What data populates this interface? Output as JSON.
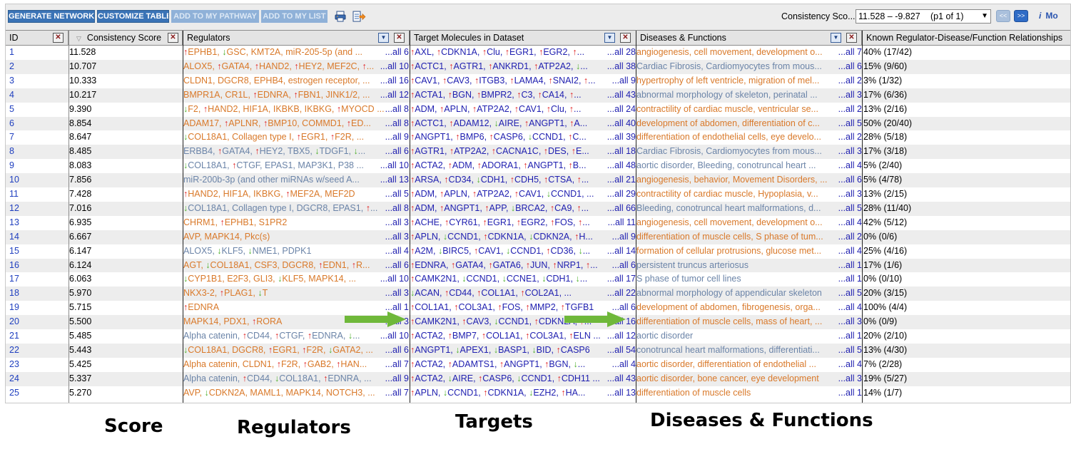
{
  "toolbar": {
    "buttons": [
      {
        "label": "GENERATE NETWORKS",
        "enabled": true
      },
      {
        "label": "CUSTOMIZE TABLE",
        "enabled": true
      },
      {
        "label": "ADD TO MY PATHWAY",
        "enabled": false
      },
      {
        "label": "ADD TO MY LIST",
        "enabled": false
      }
    ],
    "icons": [
      "printer-icon",
      "export-icon"
    ]
  },
  "filter": {
    "label": "Consistency Sco...",
    "range": "11.528 – -9.827",
    "page": "(p1 of 1)"
  },
  "info_link": "Mo",
  "columns": [
    "ID",
    "Consistency Score",
    "Regulators",
    "Target Molecules in Dataset",
    "Diseases & Functions",
    "Known Regulator-Disease/Function Relationships"
  ],
  "rows": [
    {
      "id": "1",
      "score": "11.528",
      "reg": "↑EPHB1, ↓GSC, KMT2A,  miR-205-5p (and ...",
      "reg_more": "...all 6",
      "tgt": "↑AXL, ↑CDKN1A, ↑Clu, ↑EGR1, ↑EGR2, ↑...",
      "tgt_more": "...all 28",
      "dis": "angiogenesis, cell movement,  development o...",
      "dis_more": "...all 7",
      "rel": "40% (17/42)",
      "reg_style": "orange",
      "dis_style": "orange"
    },
    {
      "id": "2",
      "score": "10.707",
      "reg": "ALOX5, ↑GATA4, ↑HAND2, ↑HEY2, MEF2C, ↑...",
      "reg_more": "...all 10",
      "tgt": "↑ACTC1, ↑AGTR1, ↑ANKRD1, ↑ATP2A2, ↓...",
      "tgt_more": "...all 38",
      "dis": "Cardiac Fibrosis,  Cardiomyocytes from mous...",
      "dis_more": "...all 6",
      "rel": "15% (9/60)",
      "reg_style": "orange",
      "dis_style": "gray"
    },
    {
      "id": "3",
      "score": "10.333",
      "reg": "CLDN1, DGCR8, EPHB4,  estrogen receptor, ...",
      "reg_more": "...all 16",
      "tgt": "↑CAV1, ↑CAV3, ↑ITGB3, ↑LAMA4, ↑SNAI2, ↑...",
      "tgt_more": "...all 9",
      "dis": "hypertrophy of left ventricle,  migration of mel...",
      "dis_more": "...all 2",
      "rel": "3% (1/32)",
      "reg_style": "orange",
      "dis_style": "orange"
    },
    {
      "id": "4",
      "score": "10.217",
      "reg": "BMPR1A, CR1L, ↑EDNRA, ↑FBN1,  JINK1/2, ...",
      "reg_more": "...all 12",
      "tgt": "↑ACTA1, ↑BGN, ↑BMPR2, ↑C3, ↑CA14, ↑...",
      "tgt_more": "...all 43",
      "dis": "abnormal morphology of skeleton,  perinatal ...",
      "dis_more": "...all 3",
      "rel": "17% (6/36)",
      "reg_style": "orange",
      "dis_style": "gray"
    },
    {
      "id": "5",
      "score": "9.390",
      "reg": "↓F2, ↑HAND2, HIF1A, IKBKB, IKBKG, ↑MYOCD ...",
      "reg_more": "...all 8",
      "tgt": "↑ADM, ↑APLN, ↑ATP2A2, ↑CAV1, ↑Clu, ↑...",
      "tgt_more": "...all 24",
      "dis": "contractility of cardiac muscle,  ventricular se...",
      "dis_more": "...all 2",
      "rel": "13% (2/16)",
      "reg_style": "orange",
      "dis_style": "orange"
    },
    {
      "id": "6",
      "score": "8.854",
      "reg": "ADAM17, ↑APLNR, ↑BMP10, COMMD1, ↑ED...",
      "reg_more": "...all 8",
      "tgt": "↑ACTC1, ↑ADAM12, ↓AIRE, ↑ANGPT1, ↑A...",
      "tgt_more": "...all 40",
      "dis": "development of abdomen,  differentiation of c...",
      "dis_more": "...all 5",
      "rel": "50% (20/40)",
      "reg_style": "orange",
      "dis_style": "orange"
    },
    {
      "id": "7",
      "score": "8.647",
      "reg": "↓COL18A1, Collagen type I, ↑EGR1, ↑F2R, ...",
      "reg_more": "...all 9",
      "tgt": "↑ANGPT1, ↑BMP6, ↑CASP6, ↓CCND1, ↑C...",
      "tgt_more": "...all 39",
      "dis": "differentiation of endothelial cells,  eye develo...",
      "dis_more": "...all 2",
      "rel": "28% (5/18)",
      "reg_style": "orange",
      "dis_style": "orange"
    },
    {
      "id": "8",
      "score": "8.485",
      "reg": "ERBB4, ↑GATA4, ↑HEY2, TBX5, ↓TDGF1, ↓...",
      "reg_more": "...all 6",
      "tgt": "↑AGTR1, ↑ATP2A2, ↑CACNA1C, ↑DES, ↑E...",
      "tgt_more": "...all 18",
      "dis": "Cardiac Fibrosis,  Cardiomyocytes from mous...",
      "dis_more": "...all 3",
      "rel": "17% (3/18)",
      "reg_style": "gray",
      "dis_style": "gray"
    },
    {
      "id": "9",
      "score": "8.083",
      "reg": "↓COL18A1, ↑CTGF, EPAS1, MAP3K1, P38 ...",
      "reg_more": "...all 10",
      "tgt": "↑ACTA2, ↑ADM, ↑ADORA1, ↑ANGPT1, ↑B...",
      "tgt_more": "...all 48",
      "dis": "aortic disorder,  Bleeding,  conotruncal heart ...",
      "dis_more": "...all 4",
      "rel": "5% (2/40)",
      "reg_style": "gray",
      "dis_style": "gray"
    },
    {
      "id": "10",
      "score": "7.856",
      "reg": "miR-200b-3p (and other miRNAs w/seed A...",
      "reg_more": "...all 13",
      "tgt": "↑ARSA, ↑CD34, ↓CDH1, ↑CDH5, ↑CTSA, ↑...",
      "tgt_more": "...all 21",
      "dis": "angiogenesis,  behavior,  Movement Disorders, ...",
      "dis_more": "...all 6",
      "rel": "5% (4/78)",
      "reg_style": "gray",
      "dis_style": "orange"
    },
    {
      "id": "11",
      "score": "7.428",
      "reg": "↑HAND2, HIF1A, IKBKG, ↑MEF2A, MEF2D",
      "reg_more": "...all 5",
      "tgt": "↑ADM, ↑APLN, ↑ATP2A2, ↑CAV1, ↓CCND1, ...",
      "tgt_more": "...all 29",
      "dis": "contractility of cardiac muscle,  Hypoplasia,  v...",
      "dis_more": "...all 3",
      "rel": "13% (2/15)",
      "reg_style": "orange",
      "dis_style": "orange"
    },
    {
      "id": "12",
      "score": "7.016",
      "reg": "↓COL18A1, Collagen type I, DGCR8, EPAS1, ↑...",
      "reg_more": "...all 8",
      "tgt": "↑ADM, ↑ANGPT1, ↑APP, ↓BRCA2, ↑CA9, ↑...",
      "tgt_more": "...all 66",
      "dis": "Bleeding,  conotruncal heart malformations,  d...",
      "dis_more": "...all 5",
      "rel": "28% (11/40)",
      "reg_style": "gray",
      "dis_style": "gray"
    },
    {
      "id": "13",
      "score": "6.935",
      "reg": "CHRM1, ↑EPHB1, S1PR2",
      "reg_more": "...all 3",
      "tgt": "↑ACHE, ↑CYR61, ↑EGR1, ↑EGR2, ↑FOS, ↑...",
      "tgt_more": "...all 11",
      "dis": "angiogenesis, cell movement,  development o...",
      "dis_more": "...all 4",
      "rel": "42% (5/12)",
      "reg_style": "orange",
      "dis_style": "orange"
    },
    {
      "id": "14",
      "score": "6.667",
      "reg": "AVP, MAPK14, Pkc(s)",
      "reg_more": "...all 3",
      "tgt": "↑APLN, ↓CCND1, ↑CDKN1A, ↓CDKN2A, ↑H...",
      "tgt_more": "...all 9",
      "dis": "differentiation of muscle cells,  S phase of tum...",
      "dis_more": "...all 2",
      "rel": "0% (0/6)",
      "reg_style": "orange",
      "dis_style": "orange"
    },
    {
      "id": "15",
      "score": "6.147",
      "reg": "ALOX5, ↓KLF5, ↓NME1, PDPK1",
      "reg_more": "...all 4",
      "tgt": "↑A2M, ↓BIRC5, ↑CAV1, ↓CCND1, ↑CD36, ↓...",
      "tgt_more": "...all 14",
      "dis": "formation of cellular protrusions,  glucose met...",
      "dis_more": "...all 4",
      "rel": "25% (4/16)",
      "reg_style": "gray",
      "dis_style": "orange"
    },
    {
      "id": "16",
      "score": "6.124",
      "reg": "AGT, ↓COL18A1, CSF3, DGCR8, ↑EDN1, ↑R...",
      "reg_more": "...all 6",
      "tgt": "↑EDNRA, ↑GATA4, ↑GATA6, ↑JUN, ↑NRP1, ↑...",
      "tgt_more": "...all 6",
      "dis": "persistent truncus arteriosus",
      "dis_more": "...all 1",
      "rel": "17% (1/6)",
      "reg_style": "orange",
      "dis_style": "gray"
    },
    {
      "id": "17",
      "score": "6.063",
      "reg": "↓CYP1B1, E2F3, GLI3, ↓KLF5, MAPK14, ...",
      "reg_more": "...all 10",
      "tgt": "↑CAMK2N1, ↓CCND1, ↓CCNE1, ↓CDH1, ↓...",
      "tgt_more": "...all 17",
      "dis": "S phase of tumor cell lines",
      "dis_more": "...all 1",
      "rel": "0% (0/10)",
      "reg_style": "orange",
      "dis_style": "gray"
    },
    {
      "id": "18",
      "score": "5.970",
      "reg": "NKX3-2, ↑PLAG1, ↓T",
      "reg_more": "...all 3",
      "tgt": "↓ACAN, ↑CD44, ↑COL1A1, ↑COL2A1, ...",
      "tgt_more": "...all 22",
      "dis": "abnormal morphology of appendicular skeleton",
      "dis_more": "...all 5",
      "rel": "20% (3/15)",
      "reg_style": "orange",
      "dis_style": "gray"
    },
    {
      "id": "19",
      "score": "5.715",
      "reg": "↑EDNRA",
      "reg_more": "...all 1",
      "tgt": "↑COL1A1, ↑COL3A1, ↑FOS, ↑MMP2, ↑TGFB1",
      "tgt_more": "...all 6",
      "dis": "development of abdomen,  fibrogenesis,  orga...",
      "dis_more": "...all 4",
      "rel": "100% (4/4)",
      "reg_style": "orange",
      "dis_style": "orange"
    },
    {
      "id": "20",
      "score": "5.500",
      "reg": "MAPK14, PDX1, ↑RORA",
      "reg_more": "...all 3",
      "tgt": "↑CAMK2N1, ↑CAV3, ↓CCND1, ↑CDKN2A, ↑...",
      "tgt_more": "...all 16",
      "dis": "differentiation of muscle cells,  mass of heart, ...",
      "dis_more": "...all 3",
      "rel": "0% (0/9)",
      "reg_style": "orange",
      "dis_style": "orange"
    },
    {
      "id": "21",
      "score": "5.485",
      "reg": "Alpha catenin, ↑CD44, ↑CTGF, ↑EDNRA, ↓...",
      "reg_more": "...all 10",
      "tgt": "↑ACTA2, ↑BMP7, ↑COL1A1, ↑COL3A1, ↑ELN ...",
      "tgt_more": "...all 12",
      "dis": "aortic disorder",
      "dis_more": "...all 1",
      "rel": "20% (2/10)",
      "reg_style": "gray",
      "dis_style": "gray"
    },
    {
      "id": "22",
      "score": "5.443",
      "reg": "↓COL18A1, DGCR8, ↑EGR1, ↑F2R, ↓GATA2, ...",
      "reg_more": "...all 6",
      "tgt": "↑ANGPT1, ↓APEX1, ↓BASP1, ↓BID, ↑CASP6",
      "tgt_more": "...all 54",
      "dis": "conotruncal heart malformations,  differentiati...",
      "dis_more": "...all 5",
      "rel": "13% (4/30)",
      "reg_style": "orange",
      "dis_style": "gray"
    },
    {
      "id": "23",
      "score": "5.425",
      "reg": "Alpha catenin, CLDN1, ↑F2R, ↑GAB2, ↑HAN...",
      "reg_more": "...all 7",
      "tgt": "↑ACTA2, ↑ADAMTS1, ↑ANGPT1, ↑BGN, ↓...",
      "tgt_more": "...all 4",
      "dis": "aortic disorder,  differentiation of endothelial ...",
      "dis_more": "...all 4",
      "rel": "7% (2/28)",
      "reg_style": "orange",
      "dis_style": "orange"
    },
    {
      "id": "24",
      "score": "5.337",
      "reg": "Alpha catenin, ↑CD44, ↓COL18A1, ↑EDNRA, ...",
      "reg_more": "...all 9",
      "tgt": "↑ACTA2, ↓AIRE, ↑CASP6, ↓CCND1, ↑CDH11 ...",
      "tgt_more": "...all 43",
      "dis": "aortic disorder,  bone cancer,  eye development",
      "dis_more": "...all 3",
      "rel": "19% (5/27)",
      "reg_style": "gray",
      "dis_style": "orange"
    },
    {
      "id": "25",
      "score": "5.270",
      "reg": "AVP, ↓CDKN2A, MAML1, MAPK14, NOTCH3, ...",
      "reg_more": "...all 7",
      "tgt": "↑APLN, ↓CCND1, ↑CDKN1A, ↓EZH2, ↑HA...",
      "tgt_more": "...all 13",
      "dis": "differentiation of muscle cells",
      "dis_more": "...all 1",
      "rel": "14% (1/7)",
      "reg_style": "orange",
      "dis_style": "orange"
    }
  ],
  "captions": {
    "score": "Score",
    "regulators": "Regulators",
    "targets": "Targets",
    "diseases": "Diseases & Functions"
  },
  "colors": {
    "up_arrow": "#e02020",
    "down_arrow": "#4caf2a",
    "orange_text": "#d9792a",
    "gray_text": "#6b84a8",
    "link_blue": "#2020b0",
    "annotation_arrow": "#6fb83a"
  }
}
